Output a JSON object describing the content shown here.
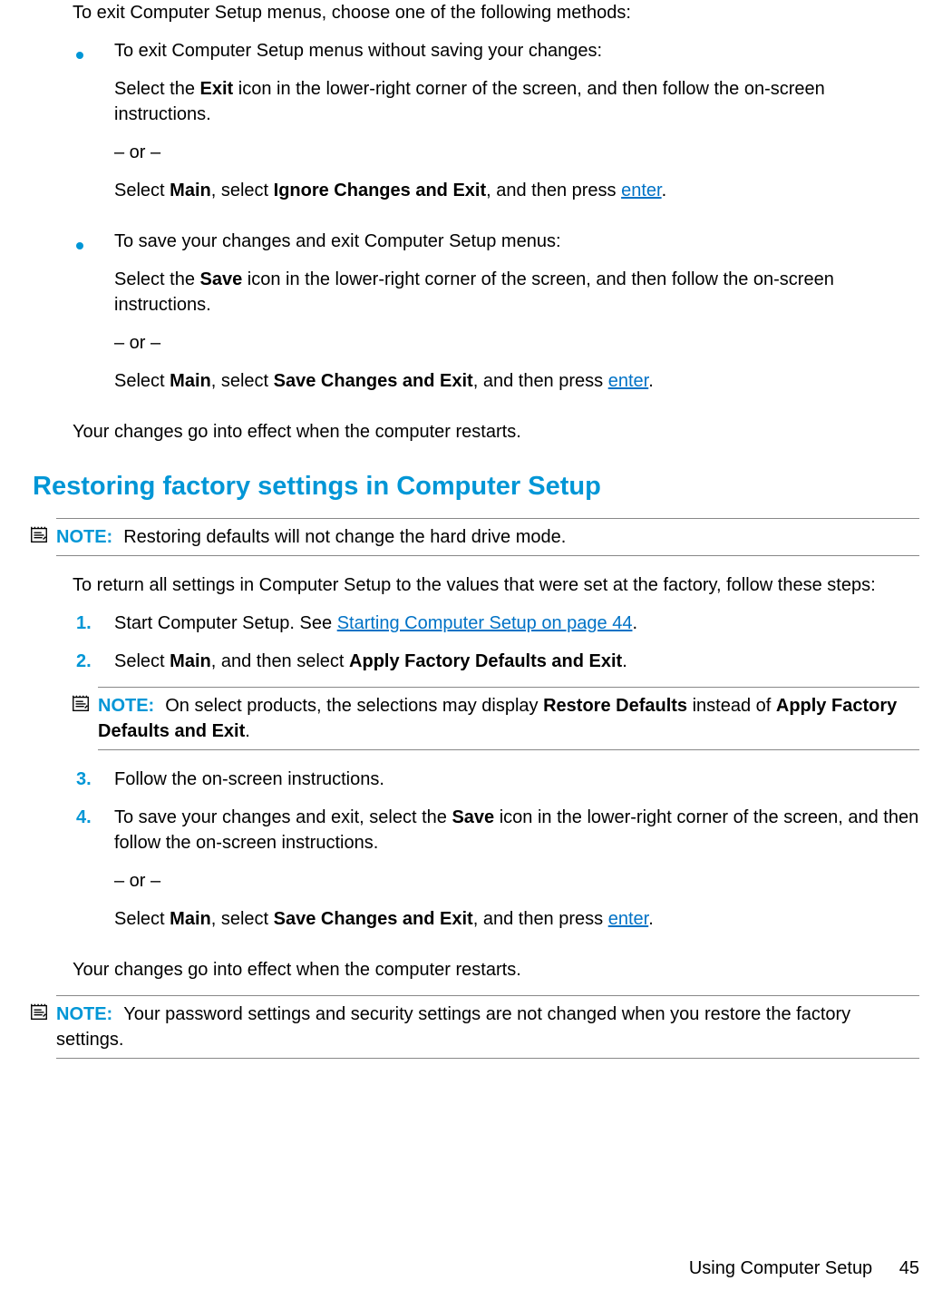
{
  "intro": "To exit Computer Setup menus, choose one of the following methods:",
  "bullets": [
    {
      "lead": "To exit Computer Setup menus without saving your changes:",
      "p2_a": "Select the ",
      "p2_b": "Exit",
      "p2_c": " icon in the lower-right corner of the screen, and then follow the on-screen instructions.",
      "or": "– or –",
      "p3_a": "Select ",
      "p3_b": "Main",
      "p3_c": ", select ",
      "p3_d": "Ignore Changes and Exit",
      "p3_e": ", and then press ",
      "p3_f": "enter",
      "p3_g": "."
    },
    {
      "lead": "To save your changes and exit Computer Setup menus:",
      "p2_a": "Select the ",
      "p2_b": "Save",
      "p2_c": " icon in the lower-right corner of the screen, and then follow the on-screen instructions.",
      "or": "– or –",
      "p3_a": "Select ",
      "p3_b": "Main",
      "p3_c": ", select ",
      "p3_d": "Save Changes and Exit",
      "p3_e": ", and then press ",
      "p3_f": "enter",
      "p3_g": "."
    }
  ],
  "after_bullets": "Your changes go into effect when the computer restarts.",
  "heading": "Restoring factory settings in Computer Setup",
  "note1": {
    "label": "NOTE:",
    "text": "Restoring defaults will not change the hard drive mode."
  },
  "return_text": "To return all settings in Computer Setup to the values that were set at the factory, follow these steps:",
  "steps": {
    "s1": {
      "num": "1.",
      "a": "Start Computer Setup. See ",
      "link": "Starting Computer Setup on page 44",
      "b": "."
    },
    "s2": {
      "num": "2.",
      "a": "Select ",
      "b": "Main",
      "c": ", and then select ",
      "d": "Apply Factory Defaults and Exit",
      "e": "."
    },
    "s3": {
      "num": "3.",
      "text": "Follow the on-screen instructions."
    },
    "s4": {
      "num": "4.",
      "a": "To save your changes and exit, select the ",
      "b": "Save",
      "c": " icon in the lower-right corner of the screen, and then follow the on-screen instructions.",
      "or": "– or –",
      "d": "Select ",
      "e": "Main",
      "f": ", select ",
      "g": "Save Changes and Exit",
      "h": ", and then press ",
      "i": "enter",
      "j": "."
    }
  },
  "note2": {
    "label": "NOTE:",
    "a": "On select products, the selections may display ",
    "b": "Restore Defaults",
    "c": " instead of ",
    "d": "Apply Factory Defaults and Exit",
    "e": "."
  },
  "after_steps": "Your changes go into effect when the computer restarts.",
  "note3": {
    "label": "NOTE:",
    "text": "Your password settings and security settings are not changed when you restore the factory settings."
  },
  "footer": {
    "title": "Using Computer Setup",
    "page": "45"
  }
}
